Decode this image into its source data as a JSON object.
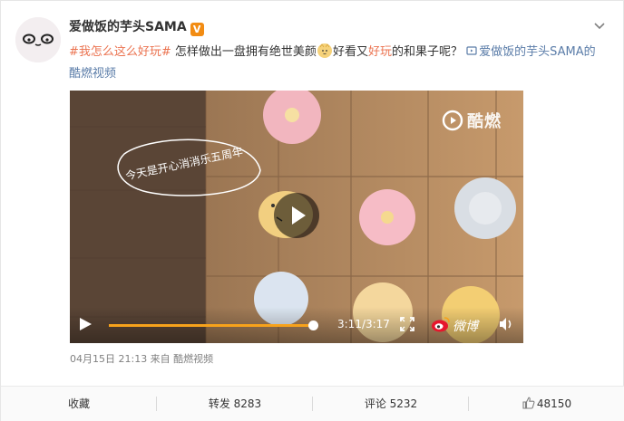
{
  "post": {
    "username": "爱做饭的芋头SAMA",
    "verified_badge": "V",
    "text": {
      "hashtag": "#我怎么这么好玩#",
      "part1": " 怎样做出一盘拥有绝世美颜",
      "part2": "好看又",
      "highlight": "好玩",
      "part3": "的和果子呢？",
      "link_label": "爱做饭的芋头SAMA的酷燃视频"
    },
    "emoji_icon": "cat-face-emoji",
    "meta": "04月15日 21:13 来自 酷燃视频"
  },
  "video": {
    "watermark": "酷燃",
    "overlay_caption": "今天是开心消消乐五周年",
    "time": "3:11/3:17",
    "progress": 0.98,
    "weibo_logo_text": "微博",
    "icons": {
      "play": "play-icon",
      "fullscreen": "fullscreen-icon",
      "volume": "volume-icon",
      "center_play": "play-circle-icon"
    },
    "accent_color": "#f7a21b"
  },
  "actions": {
    "favorite": "收藏",
    "repost": "转发 8283",
    "comment": "评论 5232",
    "like": "48150"
  },
  "colors": {
    "link": "#5a7ca8",
    "hashtag": "#eb7350"
  }
}
